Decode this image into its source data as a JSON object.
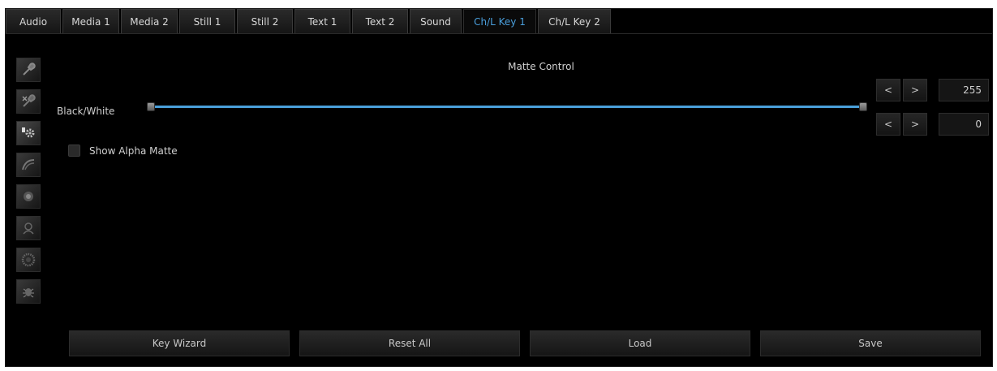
{
  "tabs": [
    {
      "label": "Audio",
      "active": false
    },
    {
      "label": "Media 1",
      "active": false
    },
    {
      "label": "Media 2",
      "active": false
    },
    {
      "label": "Still 1",
      "active": false
    },
    {
      "label": "Still 2",
      "active": false
    },
    {
      "label": "Text 1",
      "active": false
    },
    {
      "label": "Text 2",
      "active": false
    },
    {
      "label": "Sound",
      "active": false
    },
    {
      "label": "Ch/L Key 1",
      "active": true
    },
    {
      "label": "Ch/L Key 2",
      "active": false
    }
  ],
  "side_icons": [
    "eyedropper-icon",
    "eyedropper-remove-icon",
    "gear-settings-icon",
    "spill-arc-icon",
    "edge-softness-icon",
    "matte-cleanup-icon",
    "gradient-circle-icon",
    "filter-bug-icon"
  ],
  "matte": {
    "title": "Matte Control",
    "bw_label": "Black/White",
    "show_alpha_label": "Show Alpha Matte",
    "show_alpha_checked": false,
    "high_value": "255",
    "low_value": "0",
    "dec_label": "<",
    "inc_label": ">"
  },
  "buttons": {
    "key_wizard": "Key Wizard",
    "reset_all": "Reset All",
    "load": "Load",
    "save": "Save"
  },
  "colors": {
    "accent": "#4aa0da",
    "background": "#000000",
    "text": "#d0d0d0"
  }
}
